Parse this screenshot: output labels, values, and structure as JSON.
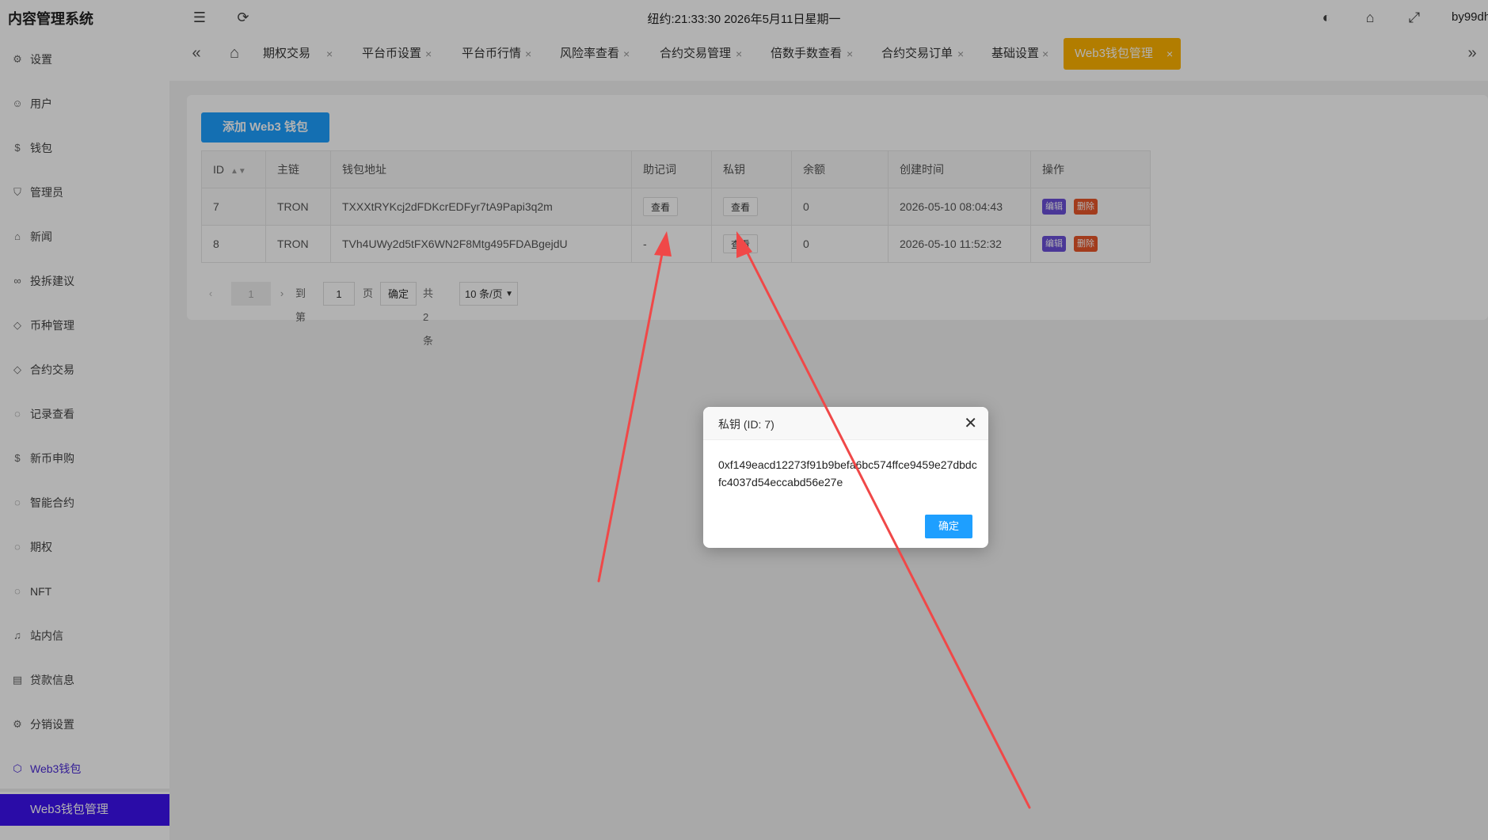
{
  "header": {
    "brand": "内容管理系统",
    "datetime": "纽约:21:33:30 2026年5月11日星期一",
    "user": "by99dh"
  },
  "tabs": [
    {
      "label": "期权交易"
    },
    {
      "label": "平台币设置"
    },
    {
      "label": "平台币行情"
    },
    {
      "label": "风险率查看"
    },
    {
      "label": "合约交易管理"
    },
    {
      "label": "倍数手数查看"
    },
    {
      "label": "合约交易订单"
    },
    {
      "label": "基础设置"
    },
    {
      "label": "Web3钱包管理"
    }
  ],
  "sidebar": {
    "items": [
      {
        "label": "设置",
        "icon": "gear-icon"
      },
      {
        "label": "用户",
        "icon": "user-icon"
      },
      {
        "label": "钱包",
        "icon": "dollar-icon"
      },
      {
        "label": "管理员",
        "icon": "shield-icon"
      },
      {
        "label": "新闻",
        "icon": "tag-icon"
      },
      {
        "label": "投拆建议",
        "icon": "infinity-icon"
      },
      {
        "label": "币种管理",
        "icon": "diamond-icon"
      },
      {
        "label": "合约交易",
        "icon": "diamond-icon"
      },
      {
        "label": "记录查看",
        "icon": "circle-icon"
      },
      {
        "label": "新币申购",
        "icon": "dollar-icon"
      },
      {
        "label": "智能合约",
        "icon": "circle-icon"
      },
      {
        "label": "期权",
        "icon": "circle-icon"
      },
      {
        "label": "NFT",
        "icon": "circle-icon"
      },
      {
        "label": "站内信",
        "icon": "bell-icon"
      },
      {
        "label": "贷款信息",
        "icon": "doc-icon"
      },
      {
        "label": "分销设置",
        "icon": "gear-icon"
      },
      {
        "label": "Web3钱包",
        "icon": "cube-icon"
      }
    ],
    "sub_active": "Web3钱包管理"
  },
  "main": {
    "add_button": "添加 Web3 钱包",
    "columns": [
      "ID",
      "主链",
      "钱包地址",
      "助记词",
      "私钥",
      "余额",
      "创建时间",
      "操作"
    ],
    "rows": [
      {
        "id": "7",
        "chain": "TRON",
        "address": "TXXXtRYKcj2dFDKcrEDFyr7tA9Papi3q2m",
        "mnemonic": "查看",
        "private_key": "查看",
        "balance": "0",
        "created": "2026-05-10 08:04:43",
        "edit": "编辑",
        "delete": "删除"
      },
      {
        "id": "8",
        "chain": "TRON",
        "address": "TVh4UWy2d5tFX6WN2F8Mtg495FDABgejdU",
        "mnemonic": "-",
        "private_key": "查看",
        "balance": "0",
        "created": "2026-05-10 11:52:32",
        "edit": "编辑",
        "delete": "删除"
      }
    ],
    "pager": {
      "current": "1",
      "goto_label": "到第",
      "goto_value": "1",
      "page_unit": "页",
      "confirm": "确定",
      "total": "共 2 条",
      "page_size": "10 条/页"
    }
  },
  "modal": {
    "title": "私钥 (ID: 7)",
    "body": "0xf149eacd12273f91b9befa6bc574ffce9459e27dbdcfc4037d54eccabd56e27e",
    "ok": "确定"
  },
  "colors": {
    "active_tab": "#ffb400",
    "primary": "#1e9fff",
    "sidebar_active": "#3d12f0",
    "edit_tag": "#6a4fd8",
    "delete_tag": "#e8562a",
    "annotation_arrow": "#f04848"
  }
}
